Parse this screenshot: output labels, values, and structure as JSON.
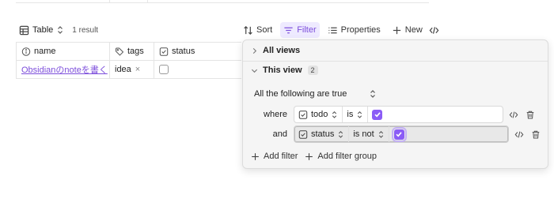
{
  "toolbar": {
    "view_label": "Table",
    "result_count": "1 result",
    "sort_label": "Sort",
    "filter_label": "Filter",
    "properties_label": "Properties",
    "new_label": "New"
  },
  "table": {
    "columns": [
      {
        "label": "name",
        "icon": "info-icon"
      },
      {
        "label": "tags",
        "icon": "tag-icon"
      },
      {
        "label": "status",
        "icon": "checkbox-icon"
      }
    ],
    "rows": [
      {
        "name": "Obsidianのnoteを書く",
        "tag": "idea",
        "tag_remove": "×",
        "status_checked": false
      }
    ]
  },
  "filter_panel": {
    "all_views_label": "All views",
    "this_view_label": "This view",
    "this_view_count": "2",
    "combinator_label": "All the following are true",
    "rules": [
      {
        "word": "where",
        "property": "todo",
        "operator": "is",
        "value_checked": true
      },
      {
        "word": "and",
        "property": "status",
        "operator": "is not",
        "value_checked": true
      }
    ],
    "add_filter_label": "Add filter",
    "add_filter_group_label": "Add filter group"
  },
  "colors": {
    "accent": "#8b5cf6",
    "link": "#7c4ddb",
    "active_bg": "#eeeaff",
    "panel_bg": "#f5f5f5"
  }
}
